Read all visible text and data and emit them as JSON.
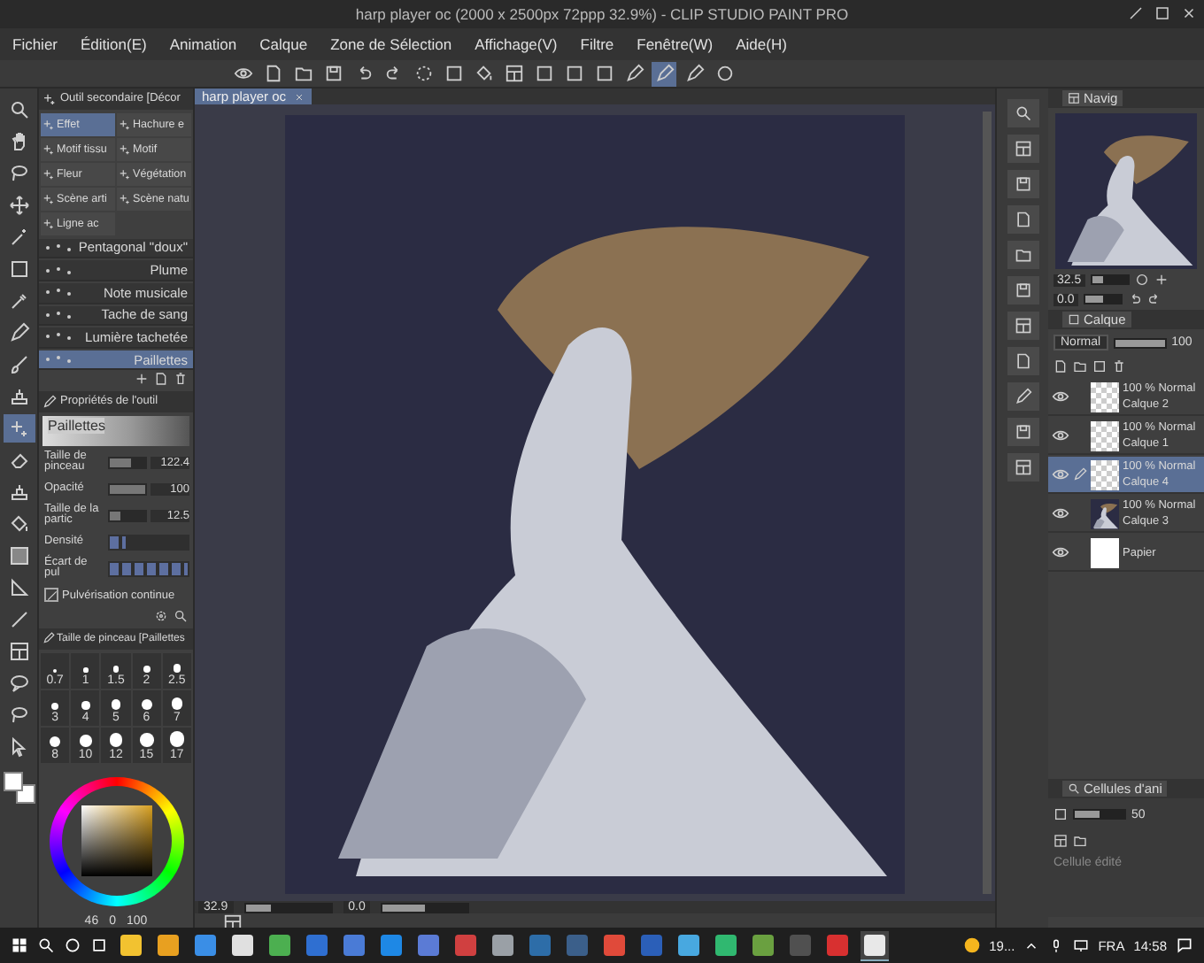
{
  "window": {
    "title": "harp player oc (2000 x 2500px 72ppp 32.9%) - CLIP STUDIO PAINT PRO"
  },
  "menu": [
    "Fichier",
    "Édition(E)",
    "Animation",
    "Calque",
    "Zone de Sélection",
    "Affichage(V)",
    "Filtre",
    "Fenêtre(W)",
    "Aide(H)"
  ],
  "toolbar": [
    {
      "kind": "eye",
      "selected": false
    },
    {
      "kind": "new",
      "selected": false
    },
    {
      "kind": "folder",
      "selected": false
    },
    {
      "kind": "save",
      "selected": false
    },
    {
      "kind": "undo",
      "selected": false
    },
    {
      "kind": "redo",
      "selected": false
    },
    {
      "kind": "dashed",
      "selected": false
    },
    {
      "kind": "square",
      "selected": false
    },
    {
      "kind": "bucket",
      "selected": false
    },
    {
      "kind": "frame",
      "selected": false
    },
    {
      "kind": "square",
      "selected": false
    },
    {
      "kind": "square",
      "selected": false
    },
    {
      "kind": "square",
      "selected": false
    },
    {
      "kind": "pen",
      "selected": false
    },
    {
      "kind": "pen",
      "selected": true
    },
    {
      "kind": "pen",
      "selected": false
    },
    {
      "kind": "help",
      "selected": false
    }
  ],
  "tools": [
    {
      "kind": "search",
      "selected": false
    },
    {
      "kind": "hand",
      "selected": false
    },
    {
      "kind": "lasso",
      "selected": false
    },
    {
      "kind": "move",
      "selected": false
    },
    {
      "kind": "wand",
      "selected": false
    },
    {
      "kind": "square",
      "selected": false
    },
    {
      "kind": "dropper",
      "selected": false
    },
    {
      "kind": "pen",
      "selected": false
    },
    {
      "kind": "brush",
      "selected": false
    },
    {
      "kind": "stamp",
      "selected": false
    },
    {
      "kind": "sparkle",
      "selected": true
    },
    {
      "kind": "eraser",
      "selected": false
    },
    {
      "kind": "stamp",
      "selected": false
    },
    {
      "kind": "bucket",
      "selected": false
    },
    {
      "kind": "gradient",
      "selected": false
    },
    {
      "kind": "triangle",
      "selected": false
    },
    {
      "kind": "line",
      "selected": false
    },
    {
      "kind": "frame",
      "selected": false
    },
    {
      "kind": "bubble",
      "selected": false
    },
    {
      "kind": "lasso",
      "selected": false
    },
    {
      "kind": "cursor",
      "selected": false
    }
  ],
  "sub_tool": {
    "title": "Outil secondaire [Décor",
    "groups": [
      {
        "label": "Effet",
        "selected": true
      },
      {
        "label": "Hachure e",
        "selected": false
      },
      {
        "label": "Motif tissu",
        "selected": false
      },
      {
        "label": "Motif",
        "selected": false
      },
      {
        "label": "Fleur",
        "selected": false
      },
      {
        "label": "Végétation",
        "selected": false
      },
      {
        "label": "Scène arti",
        "selected": false
      },
      {
        "label": "Scène natu",
        "selected": false
      },
      {
        "label": "Ligne ac",
        "selected": false
      }
    ],
    "brushes": [
      {
        "label": "Pentagonal \"doux\"",
        "selected": false
      },
      {
        "label": "Plume",
        "selected": false
      },
      {
        "label": "Note musicale",
        "selected": false
      },
      {
        "label": "Tache de sang",
        "selected": false
      },
      {
        "label": "Lumière tachetée",
        "selected": false
      },
      {
        "label": "Paillettes",
        "selected": true
      }
    ]
  },
  "tool_property": {
    "title": "Propriétés de l'outil",
    "preview": "Paillettes",
    "rows": [
      {
        "kind": "slider",
        "label": "Taille de pinceau",
        "value": "122.4",
        "level": 0.6
      },
      {
        "kind": "slider",
        "label": "Opacité",
        "value": "100",
        "level": 1
      },
      {
        "kind": "slider",
        "label": "Taille de la partic",
        "value": "12.5",
        "level": 0.3
      },
      {
        "kind": "steps",
        "label": "Densité",
        "level": 0.2
      },
      {
        "kind": "steps",
        "label": "Écart de pul",
        "level": 1
      },
      {
        "kind": "checkbox",
        "label": "Pulvérisation continue",
        "checked": true
      }
    ]
  },
  "brush_size": {
    "title": "Taille de pinceau [Paillettes",
    "sizes": [
      {
        "label": "0.7",
        "selected": false
      },
      {
        "label": "1",
        "selected": false
      },
      {
        "label": "1.5",
        "selected": false
      },
      {
        "label": "2",
        "selected": false
      },
      {
        "label": "2.5",
        "selected": false
      },
      {
        "label": "3",
        "selected": false
      },
      {
        "label": "4",
        "selected": false
      },
      {
        "label": "5",
        "selected": false
      },
      {
        "label": "6",
        "selected": false
      },
      {
        "label": "7",
        "selected": false
      },
      {
        "label": "8",
        "selected": false
      },
      {
        "label": "10",
        "selected": false
      },
      {
        "label": "12",
        "selected": false
      },
      {
        "label": "15",
        "selected": false
      },
      {
        "label": "17",
        "selected": false
      }
    ]
  },
  "color_footer": {
    "value_1": "46",
    "value_2": "0",
    "value_3": "100"
  },
  "canvas": {
    "tab": "harp player oc",
    "zoom": "32.9",
    "zoom_slider": {
      "level": 0.3
    },
    "angle": "0.0",
    "rotation_slider": {
      "level": 0.5
    }
  },
  "navigator": {
    "tab": "Navig",
    "zoom": "32.5",
    "zoom_slider": {
      "level": 0.3
    },
    "angle": "0.0",
    "rotation_slider": {
      "level": 0.5
    }
  },
  "layers": {
    "tab": "Calque",
    "blend": "Normal",
    "opacity_slider": {
      "level": 1
    },
    "opacity": "100",
    "items": [
      {
        "kind": "raster",
        "mode": "100 % Normal",
        "name": "Calque 2",
        "visible": true,
        "selected": false
      },
      {
        "kind": "raster",
        "mode": "100 % Normal",
        "name": "Calque 1",
        "visible": true,
        "selected": false
      },
      {
        "kind": "raster",
        "mode": "100 % Normal",
        "name": "Calque 4",
        "visible": true,
        "selected": true
      },
      {
        "kind": "artwork",
        "mode": "100 % Normal",
        "name": "Calque 3",
        "visible": true,
        "selected": false
      },
      {
        "kind": "paper",
        "name": "Papier",
        "visible": true,
        "selected": false
      }
    ]
  },
  "animation_cels": {
    "tab": "Cellules d'ani",
    "opacity_slider": {
      "level": 0.5
    },
    "value": "50",
    "status": "Cellule édité"
  },
  "taskbar": {
    "apps": [
      {
        "color": "#f2c230",
        "selected": false
      },
      {
        "color": "#e8a020",
        "selected": false
      },
      {
        "color": "#3a8ee6",
        "selected": false
      },
      {
        "color": "#e0e0e0",
        "selected": false
      },
      {
        "color": "#4caf50",
        "selected": false
      },
      {
        "color": "#2f6fd1",
        "selected": false
      },
      {
        "color": "#4a7bd6",
        "selected": false
      },
      {
        "color": "#1e88e5",
        "selected": false
      },
      {
        "color": "#5b7bd5",
        "selected": false
      },
      {
        "color": "#d04040",
        "selected": false
      },
      {
        "color": "#9aa0a6",
        "selected": false
      },
      {
        "color": "#2d6da8",
        "selected": false
      },
      {
        "color": "#3b5f8a",
        "selected": false
      },
      {
        "color": "#e04a3a",
        "selected": false
      },
      {
        "color": "#2b5fb8",
        "selected": false
      },
      {
        "color": "#48a8e0",
        "selected": false
      },
      {
        "color": "#30b870",
        "selected": false
      },
      {
        "color": "#6aa040",
        "selected": false
      },
      {
        "color": "#505050",
        "selected": false
      },
      {
        "color": "#d83030",
        "selected": false
      },
      {
        "color": "#e8e8e8",
        "selected": true
      }
    ],
    "weather": "19...",
    "language": "FRA",
    "time": "14:58"
  }
}
